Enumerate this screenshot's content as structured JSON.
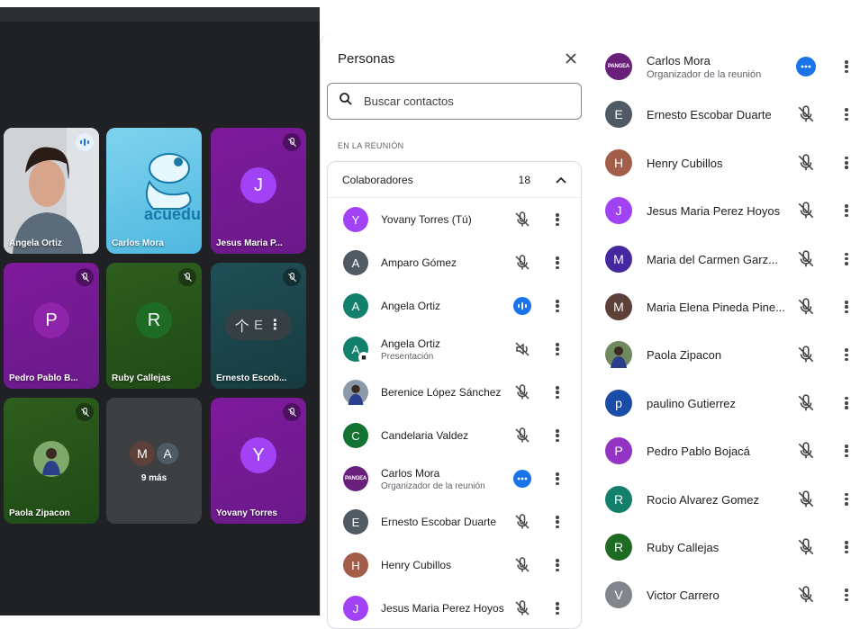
{
  "stage": {
    "tiles": [
      {
        "name": "Angela Ortiz",
        "style": "photo",
        "badge": "speaking"
      },
      {
        "name": "Carlos Mora",
        "style": "logo",
        "logo_text": "acuedu"
      },
      {
        "name": "Jesus Maria P...",
        "style": "avatar",
        "initial": "J",
        "badge": "muted"
      },
      {
        "name": "Pedro Pablo B...",
        "style": "avatar",
        "initial": "P",
        "badge": "muted"
      },
      {
        "name": "Ruby Callejas",
        "style": "avatar",
        "initial": "R",
        "badge": "muted"
      },
      {
        "name": "Ernesto Escob...",
        "style": "hover",
        "hover_letter": "E",
        "badge": "muted"
      },
      {
        "name": "Paola Zipacon",
        "style": "photo-avatar",
        "badge": "muted"
      },
      {
        "name": "9 más",
        "style": "more",
        "initials": [
          "M",
          "A"
        ]
      },
      {
        "name": "Yovany Torres",
        "style": "avatar",
        "initial": "Y",
        "badge": "muted"
      }
    ]
  },
  "panel": {
    "title": "Personas",
    "search_placeholder": "Buscar contactos",
    "section_title": "EN LA REUNIÓN",
    "group_label": "Colaboradores",
    "group_count": "18",
    "rows": [
      {
        "name": "Yovany Torres (Tú)",
        "initial": "Y",
        "color": "#a142f4",
        "mic": "muted"
      },
      {
        "name": "Amparo Gómez",
        "initial": "A",
        "color": "#4f5a64",
        "mic": "muted"
      },
      {
        "name": "Angela Ortiz",
        "initial": "A",
        "color": "#12806a",
        "mic": "speaking"
      },
      {
        "name": "Angela Ortiz",
        "sub": "Presentación",
        "initial": "A",
        "color": "#12806a",
        "mic": "presenting"
      },
      {
        "name": "Berenice López Sánchez",
        "initial": "",
        "color": "#8a9aa8",
        "mic": "muted"
      },
      {
        "name": "Candelaria Valdez",
        "initial": "C",
        "color": "#137333",
        "mic": "muted"
      },
      {
        "name": "Carlos Mora",
        "sub": "Organizador de la reunión",
        "initial": "PANGEA",
        "color": "#6a1f7a",
        "mic": "more"
      },
      {
        "name": "Ernesto Escobar Duarte",
        "initial": "E",
        "color": "#4f5a64",
        "mic": "muted"
      },
      {
        "name": "Henry Cubillos",
        "initial": "H",
        "color": "#a35e4a",
        "mic": "muted"
      },
      {
        "name": "Jesus Maria Perez Hoyos",
        "initial": "J",
        "color": "#a142f4",
        "mic": "muted"
      }
    ]
  },
  "right_list": {
    "rows": [
      {
        "name": "Carlos Mora",
        "sub": "Organizador de la reunión",
        "initial": "PANGEA",
        "color": "#6a1f7a",
        "mic": "more"
      },
      {
        "name": "Ernesto Escobar Duarte",
        "initial": "E",
        "color": "#4f5a64",
        "mic": "muted"
      },
      {
        "name": "Henry Cubillos",
        "initial": "H",
        "color": "#a35e4a",
        "mic": "muted"
      },
      {
        "name": "Jesus Maria Perez Hoyos",
        "initial": "J",
        "color": "#a142f4",
        "mic": "muted"
      },
      {
        "name": "Maria del Carmen Garz...",
        "initial": "M",
        "color": "#4527a0",
        "mic": "muted"
      },
      {
        "name": "Maria Elena Pineda Pine...",
        "initial": "M",
        "color": "#5d4037",
        "mic": "muted"
      },
      {
        "name": "Paola Zipacon",
        "initial": "",
        "color": "#6f8a5e",
        "mic": "muted"
      },
      {
        "name": "paulino Gutierrez",
        "initial": "p",
        "color": "#1a4da8",
        "mic": "muted"
      },
      {
        "name": "Pedro Pablo Bojacá",
        "initial": "P",
        "color": "#9334c4",
        "mic": "muted"
      },
      {
        "name": "Rocio Alvarez Gomez",
        "initial": "R",
        "color": "#12806a",
        "mic": "muted"
      },
      {
        "name": "Ruby Callejas",
        "initial": "R",
        "color": "#1e6b23",
        "mic": "muted"
      },
      {
        "name": "Victor Carrero",
        "initial": "V",
        "color": "#80868b",
        "mic": "muted"
      }
    ]
  }
}
